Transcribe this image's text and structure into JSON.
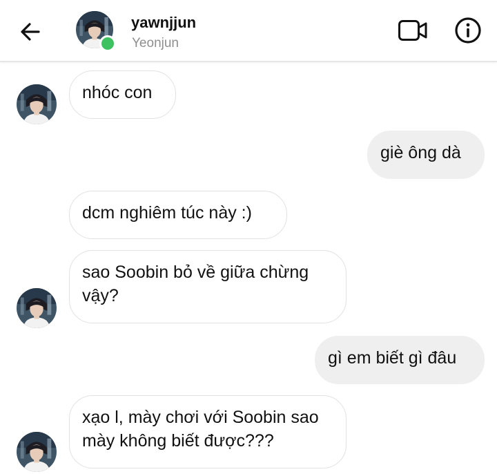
{
  "header": {
    "username": "yawnjjun",
    "display_name": "Yeonjun",
    "back_icon": "arrow-left-icon",
    "video_icon": "video-camera-icon",
    "info_icon": "info-circle-icon",
    "online_color": "#3ec261"
  },
  "messages": [
    {
      "side": "in",
      "text": "nhóc con"
    },
    {
      "side": "out",
      "text": "giè ông dà"
    },
    {
      "side": "in",
      "text": "dcm nghiêm túc này :)"
    },
    {
      "side": "in",
      "text": "sao Soobin bỏ về giữa chừng vậy?"
    },
    {
      "side": "out",
      "text": "gì em biết gì đâu"
    },
    {
      "side": "in",
      "text": "xạo l, mày chơi với Soobin sao mày không biết được???"
    }
  ],
  "colors": {
    "outgoing_bubble": "#efefef",
    "incoming_border": "#e2e2e2"
  }
}
